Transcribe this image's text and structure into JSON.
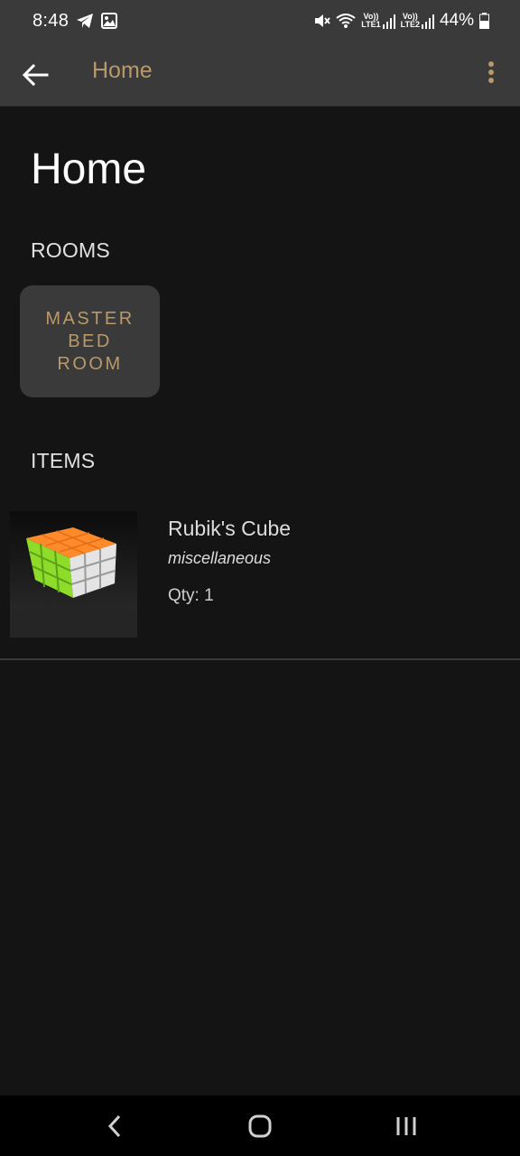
{
  "status_bar": {
    "time": "8:48",
    "battery": "44%",
    "sim1": "LTE1",
    "sim2": "LTE2",
    "volte": "Vo))"
  },
  "app_bar": {
    "title": "Home"
  },
  "page": {
    "title": "Home",
    "rooms_label": "ROOMS",
    "items_label": "ITEMS"
  },
  "rooms": [
    {
      "label": "MASTER BED ROOM"
    }
  ],
  "items": [
    {
      "name": "Rubik's Cube",
      "category": "miscellaneous",
      "qty": "Qty: 1"
    }
  ],
  "colors": {
    "accent": "#b9996a",
    "background": "#141414",
    "bar": "#3a3a3a"
  }
}
